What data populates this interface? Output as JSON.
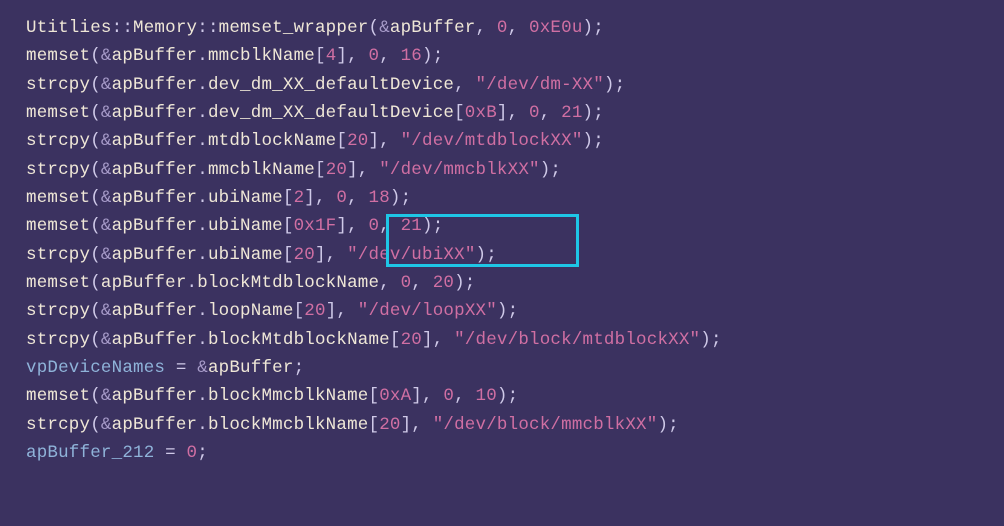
{
  "highlight": {
    "top_line": 7,
    "left_ch": 34,
    "width_ch": 18,
    "height_lines": 2
  },
  "lines": [
    [
      {
        "c": "id",
        "t": "Utitlies"
      },
      {
        "c": "punc",
        "t": "::"
      },
      {
        "c": "id",
        "t": "Memory"
      },
      {
        "c": "punc",
        "t": "::"
      },
      {
        "c": "id",
        "t": "memset_wrapper"
      },
      {
        "c": "punc",
        "t": "("
      },
      {
        "c": "amp",
        "t": "&"
      },
      {
        "c": "id",
        "t": "apBuffer"
      },
      {
        "c": "punc",
        "t": ", "
      },
      {
        "c": "num",
        "t": "0"
      },
      {
        "c": "punc",
        "t": ", "
      },
      {
        "c": "num",
        "t": "0xE0u"
      },
      {
        "c": "punc",
        "t": ");"
      }
    ],
    [
      {
        "c": "id",
        "t": "memset"
      },
      {
        "c": "punc",
        "t": "("
      },
      {
        "c": "amp",
        "t": "&"
      },
      {
        "c": "id",
        "t": "apBuffer"
      },
      {
        "c": "punc",
        "t": "."
      },
      {
        "c": "id",
        "t": "mmcblkName"
      },
      {
        "c": "punc",
        "t": "["
      },
      {
        "c": "num",
        "t": "4"
      },
      {
        "c": "punc",
        "t": "], "
      },
      {
        "c": "num",
        "t": "0"
      },
      {
        "c": "punc",
        "t": ", "
      },
      {
        "c": "num",
        "t": "16"
      },
      {
        "c": "punc",
        "t": ");"
      }
    ],
    [
      {
        "c": "id",
        "t": "strcpy"
      },
      {
        "c": "punc",
        "t": "("
      },
      {
        "c": "amp",
        "t": "&"
      },
      {
        "c": "id",
        "t": "apBuffer"
      },
      {
        "c": "punc",
        "t": "."
      },
      {
        "c": "id",
        "t": "dev_dm_XX_defaultDevice"
      },
      {
        "c": "punc",
        "t": ", "
      },
      {
        "c": "str",
        "t": "\"/dev/dm-XX\""
      },
      {
        "c": "punc",
        "t": ");"
      }
    ],
    [
      {
        "c": "id",
        "t": "memset"
      },
      {
        "c": "punc",
        "t": "("
      },
      {
        "c": "amp",
        "t": "&"
      },
      {
        "c": "id",
        "t": "apBuffer"
      },
      {
        "c": "punc",
        "t": "."
      },
      {
        "c": "id",
        "t": "dev_dm_XX_defaultDevice"
      },
      {
        "c": "punc",
        "t": "["
      },
      {
        "c": "num",
        "t": "0xB"
      },
      {
        "c": "punc",
        "t": "], "
      },
      {
        "c": "num",
        "t": "0"
      },
      {
        "c": "punc",
        "t": ", "
      },
      {
        "c": "num",
        "t": "21"
      },
      {
        "c": "punc",
        "t": ");"
      }
    ],
    [
      {
        "c": "id",
        "t": "strcpy"
      },
      {
        "c": "punc",
        "t": "("
      },
      {
        "c": "amp",
        "t": "&"
      },
      {
        "c": "id",
        "t": "apBuffer"
      },
      {
        "c": "punc",
        "t": "."
      },
      {
        "c": "id",
        "t": "mtdblockName"
      },
      {
        "c": "punc",
        "t": "["
      },
      {
        "c": "num",
        "t": "20"
      },
      {
        "c": "punc",
        "t": "], "
      },
      {
        "c": "str",
        "t": "\"/dev/mtdblockXX\""
      },
      {
        "c": "punc",
        "t": ");"
      }
    ],
    [
      {
        "c": "id",
        "t": "strcpy"
      },
      {
        "c": "punc",
        "t": "("
      },
      {
        "c": "amp",
        "t": "&"
      },
      {
        "c": "id",
        "t": "apBuffer"
      },
      {
        "c": "punc",
        "t": "."
      },
      {
        "c": "id",
        "t": "mmcblkName"
      },
      {
        "c": "punc",
        "t": "["
      },
      {
        "c": "num",
        "t": "20"
      },
      {
        "c": "punc",
        "t": "], "
      },
      {
        "c": "str",
        "t": "\"/dev/mmcblkXX\""
      },
      {
        "c": "punc",
        "t": ");"
      }
    ],
    [
      {
        "c": "id",
        "t": "memset"
      },
      {
        "c": "punc",
        "t": "("
      },
      {
        "c": "amp",
        "t": "&"
      },
      {
        "c": "id",
        "t": "apBuffer"
      },
      {
        "c": "punc",
        "t": "."
      },
      {
        "c": "id",
        "t": "ubiName"
      },
      {
        "c": "punc",
        "t": "["
      },
      {
        "c": "num",
        "t": "2"
      },
      {
        "c": "punc",
        "t": "], "
      },
      {
        "c": "num",
        "t": "0"
      },
      {
        "c": "punc",
        "t": ", "
      },
      {
        "c": "num",
        "t": "18"
      },
      {
        "c": "punc",
        "t": ");"
      }
    ],
    [
      {
        "c": "id",
        "t": "memset"
      },
      {
        "c": "punc",
        "t": "("
      },
      {
        "c": "amp",
        "t": "&"
      },
      {
        "c": "id",
        "t": "apBuffer"
      },
      {
        "c": "punc",
        "t": "."
      },
      {
        "c": "id",
        "t": "ubiName"
      },
      {
        "c": "punc",
        "t": "["
      },
      {
        "c": "num",
        "t": "0x1F"
      },
      {
        "c": "punc",
        "t": "], "
      },
      {
        "c": "num",
        "t": "0"
      },
      {
        "c": "punc",
        "t": ", "
      },
      {
        "c": "num",
        "t": "21"
      },
      {
        "c": "punc",
        "t": ");"
      }
    ],
    [
      {
        "c": "id",
        "t": "strcpy"
      },
      {
        "c": "punc",
        "t": "("
      },
      {
        "c": "amp",
        "t": "&"
      },
      {
        "c": "id",
        "t": "apBuffer"
      },
      {
        "c": "punc",
        "t": "."
      },
      {
        "c": "id",
        "t": "ubiName"
      },
      {
        "c": "punc",
        "t": "["
      },
      {
        "c": "num",
        "t": "20"
      },
      {
        "c": "punc",
        "t": "], "
      },
      {
        "c": "str",
        "t": "\"/dev/ubiXX\""
      },
      {
        "c": "punc",
        "t": ");"
      }
    ],
    [
      {
        "c": "id",
        "t": "memset"
      },
      {
        "c": "punc",
        "t": "("
      },
      {
        "c": "id",
        "t": "apBuffer"
      },
      {
        "c": "punc",
        "t": "."
      },
      {
        "c": "id",
        "t": "blockMtdblockName"
      },
      {
        "c": "punc",
        "t": ", "
      },
      {
        "c": "num",
        "t": "0"
      },
      {
        "c": "punc",
        "t": ", "
      },
      {
        "c": "num",
        "t": "20"
      },
      {
        "c": "punc",
        "t": ");"
      }
    ],
    [
      {
        "c": "id",
        "t": "strcpy"
      },
      {
        "c": "punc",
        "t": "("
      },
      {
        "c": "amp",
        "t": "&"
      },
      {
        "c": "id",
        "t": "apBuffer"
      },
      {
        "c": "punc",
        "t": "."
      },
      {
        "c": "id",
        "t": "loopName"
      },
      {
        "c": "punc",
        "t": "["
      },
      {
        "c": "num",
        "t": "20"
      },
      {
        "c": "punc",
        "t": "], "
      },
      {
        "c": "str",
        "t": "\"/dev/loopXX\""
      },
      {
        "c": "punc",
        "t": ");"
      }
    ],
    [
      {
        "c": "id",
        "t": "strcpy"
      },
      {
        "c": "punc",
        "t": "("
      },
      {
        "c": "amp",
        "t": "&"
      },
      {
        "c": "id",
        "t": "apBuffer"
      },
      {
        "c": "punc",
        "t": "."
      },
      {
        "c": "id",
        "t": "blockMtdblockName"
      },
      {
        "c": "punc",
        "t": "["
      },
      {
        "c": "num",
        "t": "20"
      },
      {
        "c": "punc",
        "t": "], "
      },
      {
        "c": "str",
        "t": "\"/dev/block/mtdblockXX\""
      },
      {
        "c": "punc",
        "t": ");"
      }
    ],
    [
      {
        "c": "fn",
        "t": "vpDeviceNames"
      },
      {
        "c": "punc",
        "t": " = "
      },
      {
        "c": "amp",
        "t": "&"
      },
      {
        "c": "id",
        "t": "apBuffer"
      },
      {
        "c": "punc",
        "t": ";"
      }
    ],
    [
      {
        "c": "id",
        "t": "memset"
      },
      {
        "c": "punc",
        "t": "("
      },
      {
        "c": "amp",
        "t": "&"
      },
      {
        "c": "id",
        "t": "apBuffer"
      },
      {
        "c": "punc",
        "t": "."
      },
      {
        "c": "id",
        "t": "blockMmcblkName"
      },
      {
        "c": "punc",
        "t": "["
      },
      {
        "c": "num",
        "t": "0xA"
      },
      {
        "c": "punc",
        "t": "], "
      },
      {
        "c": "num",
        "t": "0"
      },
      {
        "c": "punc",
        "t": ", "
      },
      {
        "c": "num",
        "t": "10"
      },
      {
        "c": "punc",
        "t": ");"
      }
    ],
    [
      {
        "c": "id",
        "t": "strcpy"
      },
      {
        "c": "punc",
        "t": "("
      },
      {
        "c": "amp",
        "t": "&"
      },
      {
        "c": "id",
        "t": "apBuffer"
      },
      {
        "c": "punc",
        "t": "."
      },
      {
        "c": "id",
        "t": "blockMmcblkName"
      },
      {
        "c": "punc",
        "t": "["
      },
      {
        "c": "num",
        "t": "20"
      },
      {
        "c": "punc",
        "t": "], "
      },
      {
        "c": "str",
        "t": "\"/dev/block/mmcblkXX\""
      },
      {
        "c": "punc",
        "t": ");"
      }
    ],
    [
      {
        "c": "fn",
        "t": "apBuffer_212"
      },
      {
        "c": "punc",
        "t": " = "
      },
      {
        "c": "num",
        "t": "0"
      },
      {
        "c": "punc",
        "t": ";"
      }
    ]
  ]
}
